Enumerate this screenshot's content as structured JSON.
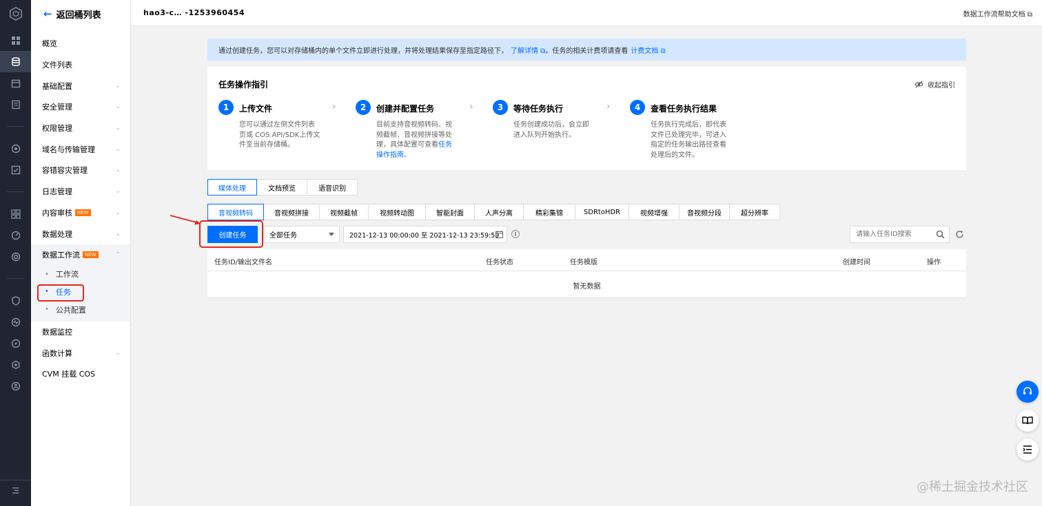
{
  "colors": {
    "accent": "#006eff",
    "highlight_red": "#e5261c",
    "new_badge": "#ff7200",
    "rail_bg": "#202531"
  },
  "sidebar": {
    "back_label": "返回桶列表",
    "items": [
      {
        "label": "概览"
      },
      {
        "label": "文件列表"
      },
      {
        "label": "基础配置",
        "chevron": true
      },
      {
        "label": "安全管理",
        "chevron": true
      },
      {
        "label": "权限管理",
        "chevron": true
      },
      {
        "label": "域名与传输管理",
        "chevron": true
      },
      {
        "label": "容错容灾管理",
        "chevron": true
      },
      {
        "label": "日志管理",
        "chevron": true
      },
      {
        "label": "内容审核",
        "badge": "NEW",
        "chevron": true
      },
      {
        "label": "数据处理",
        "chevron": true
      }
    ],
    "workflow_group": {
      "label": "数据工作流",
      "badge": "NEW",
      "subs": [
        "工作流",
        "任务",
        "公共配置"
      ]
    },
    "items_after": [
      {
        "label": "数据监控"
      },
      {
        "label": "函数计算",
        "chevron": true
      },
      {
        "label": "CVM 挂载 COS"
      }
    ]
  },
  "topbar": {
    "bucket_name": "hao3-c…  -1253960454",
    "help_link": "数据工作流帮助文档"
  },
  "banner": {
    "text": "通过创建任务，您可以对存储桶内的单个文件立即进行处理，并将处理结果保存至指定路径下，",
    "link1": "了解详情",
    "text2": "。任务的相关计费项请查看",
    "link2": "计费文档"
  },
  "guide": {
    "title": "任务操作指引",
    "collapse_label": "收起指引",
    "steps": [
      {
        "num": "1",
        "title": "上传文件",
        "desc": "您可以通过左侧文件列表页或 COS API/SDK上传文件至当前存储桶。"
      },
      {
        "num": "2",
        "title": "创建并配置任务",
        "desc": "目前支持音视频转码、视频截帧、音视频拼接等处理，具体配置可查看",
        "desc_link": "任务操作指南",
        "desc_end": "。"
      },
      {
        "num": "3",
        "title": "等待任务执行",
        "desc": "任务创建成功后，会立即进入队列开始执行。"
      },
      {
        "num": "4",
        "title": "查看任务执行结果",
        "desc": "任务执行完成后，即代表文件已处理完毕，可进入指定的任务输出路径查看处理后的文件。"
      }
    ]
  },
  "category_tabs": [
    {
      "label": "媒体处理",
      "active": true
    },
    {
      "label": "文档预览"
    },
    {
      "label": "语音识别"
    }
  ],
  "type_tabs": [
    {
      "label": "音视频转码",
      "active": true
    },
    {
      "label": "音视频拼接"
    },
    {
      "label": "视频截帧"
    },
    {
      "label": "视频转动图"
    },
    {
      "label": "智能封面"
    },
    {
      "label": "人声分离"
    },
    {
      "label": "精彩集锦"
    },
    {
      "label": "SDRtoHDR"
    },
    {
      "label": "视频增强"
    },
    {
      "label": "音视频分段"
    },
    {
      "label": "超分辨率"
    }
  ],
  "toolbar": {
    "create_label": "创建任务",
    "filter_value": "全部任务",
    "date_range": "2021-12-13 00:00:00 至 2021-12-13 23:59:59",
    "search_placeholder": "请输入任务ID搜索"
  },
  "table": {
    "headers": [
      "任务ID/输出文件名",
      "任务状态",
      "任务模版",
      "创建时间",
      "操作"
    ],
    "empty_text": "暂无数据"
  },
  "watermark": "@稀土掘金技术社区"
}
